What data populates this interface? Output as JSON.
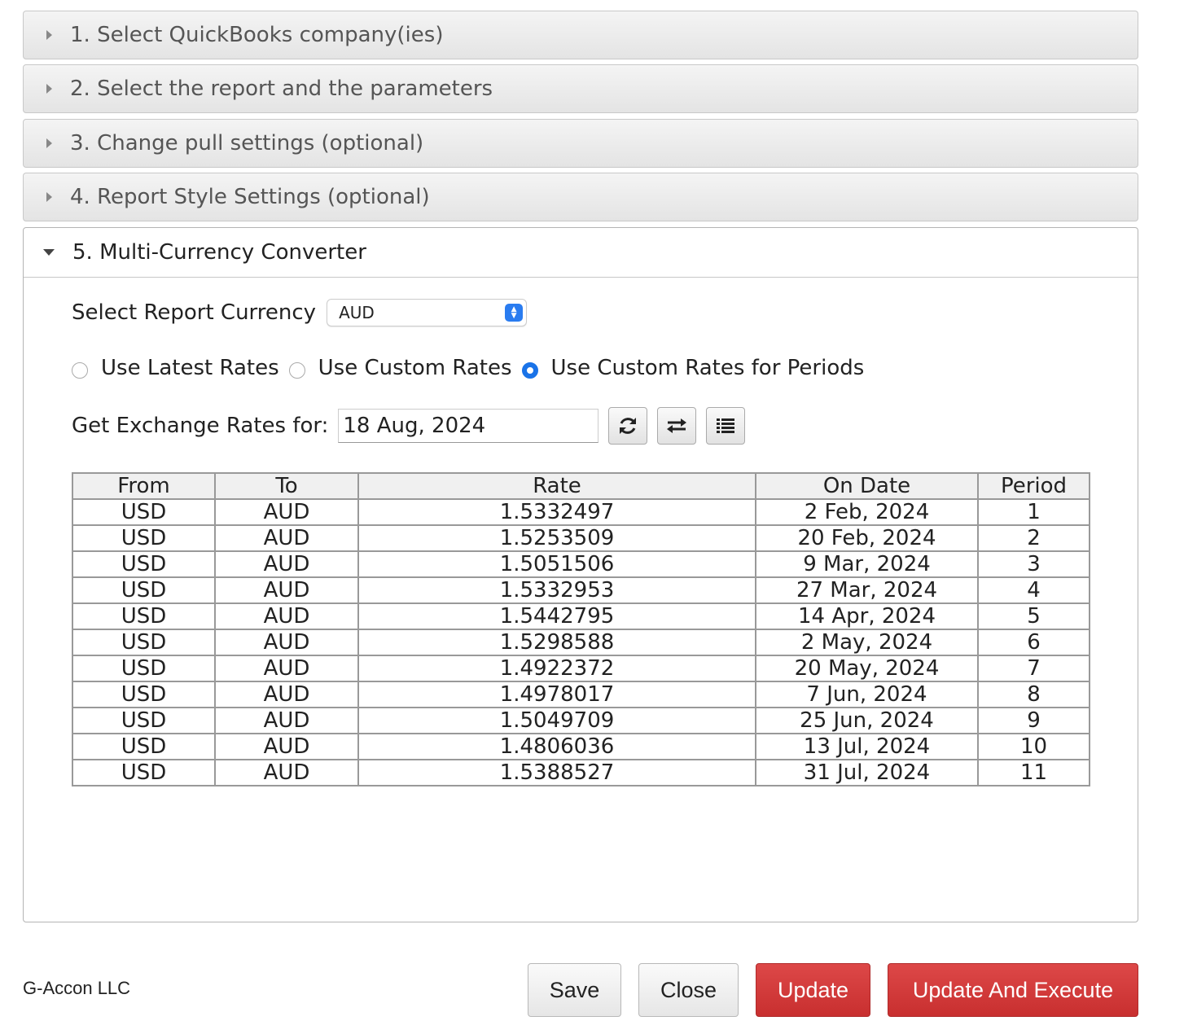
{
  "sections": [
    {
      "label": "1. Select QuickBooks company(ies)"
    },
    {
      "label": "2. Select the report and the parameters"
    },
    {
      "label": "3. Change pull settings (optional)"
    },
    {
      "label": "4. Report Style Settings (optional)"
    }
  ],
  "converter": {
    "title": "5. Multi-Currency Converter",
    "currency_label": "Select Report Currency",
    "currency_value": "AUD",
    "radios": [
      {
        "label": "Use Latest Rates",
        "checked": false
      },
      {
        "label": "Use Custom Rates",
        "checked": false
      },
      {
        "label": "Use Custom Rates for Periods",
        "checked": true
      }
    ],
    "date_label": "Get Exchange Rates for:",
    "date_value": "18 Aug, 2024",
    "icons": [
      "refresh-icon",
      "swap-icon",
      "list-icon"
    ],
    "table": {
      "headers": [
        "From",
        "To",
        "Rate",
        "On Date",
        "Period"
      ],
      "rows": [
        [
          "USD",
          "AUD",
          "1.5332497",
          "2 Feb, 2024",
          "1"
        ],
        [
          "USD",
          "AUD",
          "1.5253509",
          "20 Feb, 2024",
          "2"
        ],
        [
          "USD",
          "AUD",
          "1.5051506",
          "9 Mar, 2024",
          "3"
        ],
        [
          "USD",
          "AUD",
          "1.5332953",
          "27 Mar, 2024",
          "4"
        ],
        [
          "USD",
          "AUD",
          "1.5442795",
          "14 Apr, 2024",
          "5"
        ],
        [
          "USD",
          "AUD",
          "1.5298588",
          "2 May, 2024",
          "6"
        ],
        [
          "USD",
          "AUD",
          "1.4922372",
          "20 May, 2024",
          "7"
        ],
        [
          "USD",
          "AUD",
          "1.4978017",
          "7 Jun, 2024",
          "8"
        ],
        [
          "USD",
          "AUD",
          "1.5049709",
          "25 Jun, 2024",
          "9"
        ],
        [
          "USD",
          "AUD",
          "1.4806036",
          "13 Jul, 2024",
          "10"
        ],
        [
          "USD",
          "AUD",
          "1.5388527",
          "31 Jul, 2024",
          "11"
        ]
      ]
    }
  },
  "footer": {
    "brand": "G-Accon LLC",
    "save": "Save",
    "close": "Close",
    "update": "Update",
    "update_execute": "Update And Execute"
  },
  "colors": {
    "accent_blue": "#1a73e8",
    "danger_red": "#c82f2f"
  }
}
